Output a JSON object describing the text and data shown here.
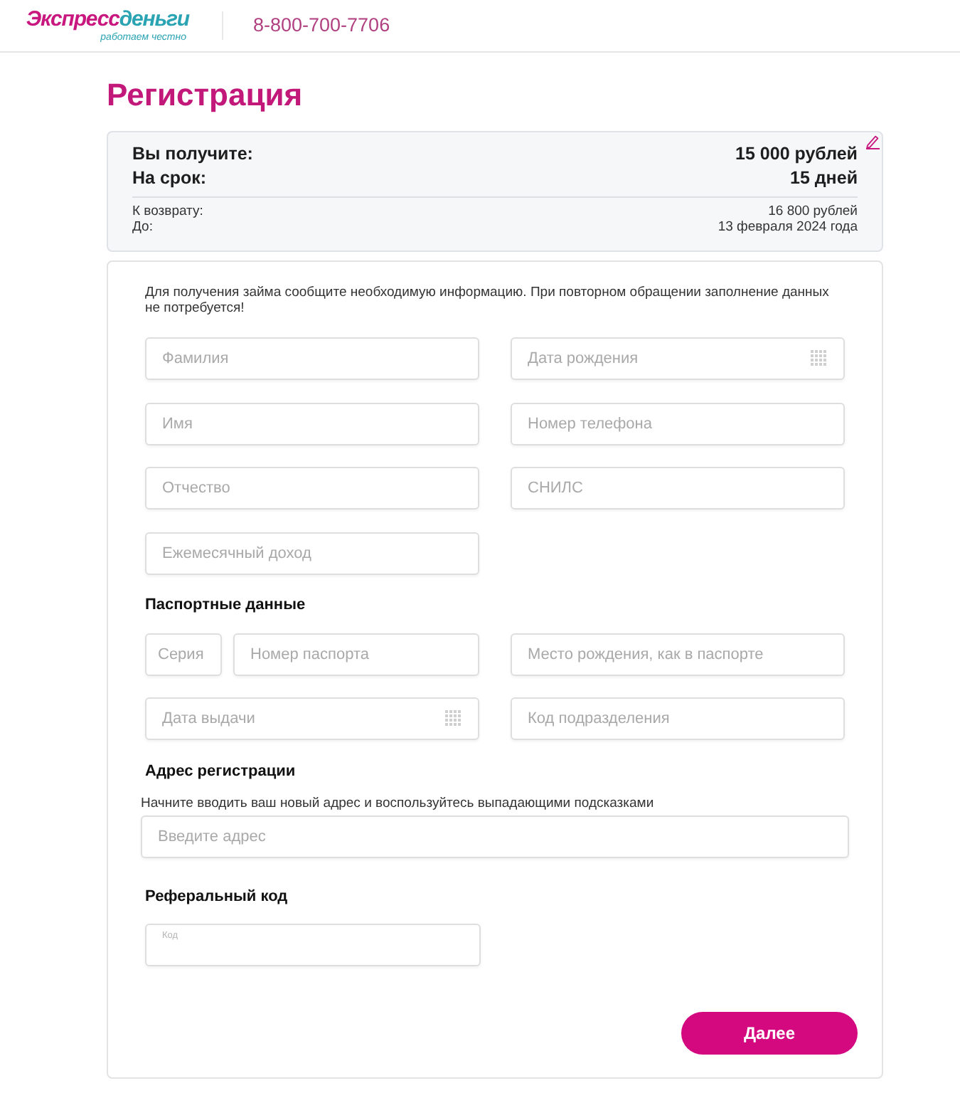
{
  "header": {
    "logo": {
      "part_1": "Экспресс",
      "part_2": "деньги",
      "tagline": "работаем честно"
    },
    "phone": "8-800-700-7706"
  },
  "title": "Регистрация",
  "summary": {
    "main_rows": [
      {
        "label": "Вы получите:",
        "value": "15 000 рублей"
      },
      {
        "label": "На срок:",
        "value": "15 дней"
      }
    ],
    "detail_rows": [
      {
        "label": "К возврату:",
        "value": "16 800 рублей"
      },
      {
        "label": "До:",
        "value": "13 февраля 2024 года"
      }
    ]
  },
  "form": {
    "intro": "Для получения займа сообщите необходимую информацию. При повторном обращении заполнение данных не потребуется!",
    "personal_fields": [
      {
        "placeholder": "Фамилия",
        "kind": "text"
      },
      {
        "placeholder": "Дата рождения",
        "kind": "date"
      },
      {
        "placeholder": "Имя",
        "kind": "text"
      },
      {
        "placeholder": "Номер телефона",
        "kind": "text"
      },
      {
        "placeholder": "Отчество",
        "kind": "text"
      },
      {
        "placeholder": "СНИЛС",
        "kind": "text"
      },
      {
        "placeholder": "Ежемесячный доход",
        "kind": "text"
      }
    ],
    "passport": {
      "title": "Паспортные данные",
      "fields": [
        {
          "placeholder": "Серия",
          "kind": "short"
        },
        {
          "placeholder": "Номер паспорта",
          "kind": "text"
        },
        {
          "placeholder": "Место рождения, как в паспорте",
          "kind": "text"
        },
        {
          "placeholder": "Дата выдачи",
          "kind": "date"
        },
        {
          "placeholder": "Код подразделения",
          "kind": "text"
        }
      ]
    },
    "address": {
      "title": "Адрес регистрации",
      "hint": "Начните вводить ваш новый адрес и воспользуйтесь выпадающими подсказками",
      "field": {
        "placeholder": "Введите адрес"
      }
    },
    "referral": {
      "title": "Реферальный код",
      "field": {
        "label": "Код"
      }
    },
    "submit_button": {
      "label": "Далее"
    }
  }
}
